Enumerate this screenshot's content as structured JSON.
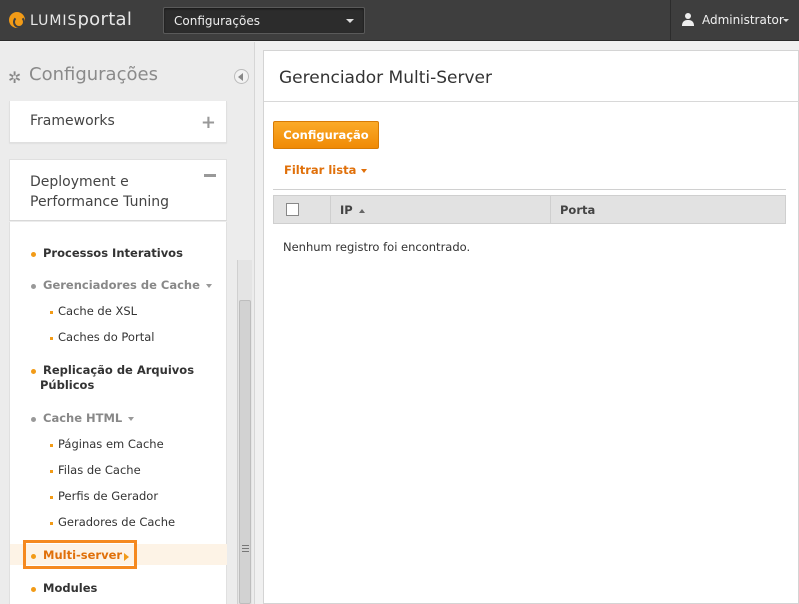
{
  "topbar": {
    "logo_prefix": "LUMIS",
    "logo_suffix": "portal",
    "section_select": "Configurações",
    "user": "Administrator"
  },
  "sidebar": {
    "title": "Configurações",
    "panels": {
      "frameworks": "Frameworks",
      "deployment": "Deployment e Performance Tuning"
    },
    "items": {
      "processos": "Processos Interativos",
      "gerenciadores": "Gerenciadores de Cache",
      "cache_xsl": "Cache de XSL",
      "caches_portal": "Caches do Portal",
      "replicacao_1": "Replicação de Arquivos",
      "replicacao_2": "Públicos",
      "cache_html": "Cache HTML",
      "paginas": "Páginas em Cache",
      "filas": "Filas de Cache",
      "perfis": "Perfis de Gerador",
      "geradores": "Geradores de Cache",
      "multiserver": "Multi-server",
      "modules": "Modules"
    }
  },
  "main": {
    "title": "Gerenciador Multi-Server",
    "config_button": "Configuração",
    "filter_link": "Filtrar lista",
    "columns": [
      "IP",
      "Porta"
    ],
    "empty_message": "Nenhum registro foi encontrado."
  },
  "colors": {
    "accent": "#f29b17",
    "topbar": "#3e3e3e",
    "highlight_border": "#f5891f"
  }
}
